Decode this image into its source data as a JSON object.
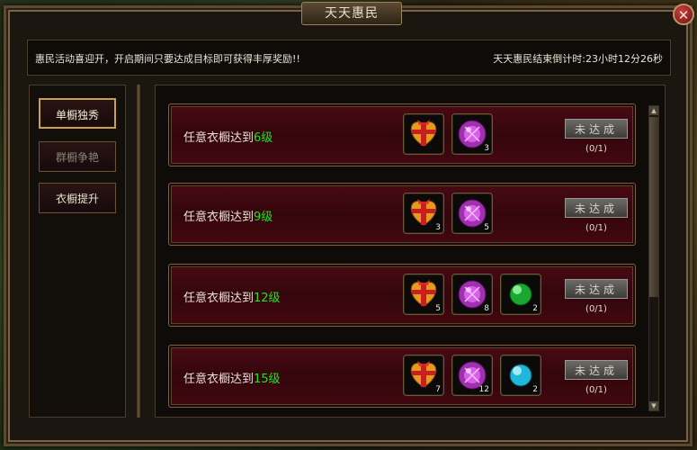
{
  "window": {
    "title": "天天惠民",
    "close_glyph": "✕"
  },
  "notice": {
    "left": "惠民活动喜迎开，开启期间只要达成目标即可获得丰厚奖励!!",
    "right": "天天惠民结束倒计时:23小时12分26秒"
  },
  "tabs": [
    {
      "label": "单橱独秀",
      "state": "active"
    },
    {
      "label": "群橱争艳",
      "state": "disabled"
    },
    {
      "label": "衣橱提升",
      "state": "normal"
    }
  ],
  "rows": [
    {
      "label_prefix": "任意衣橱达到",
      "level": "6级",
      "status": "未达成",
      "progress": "(0/1)",
      "items": [
        {
          "icon": "gift-box-icon",
          "count": ""
        },
        {
          "icon": "purple-orb-icon",
          "count": "3"
        }
      ]
    },
    {
      "label_prefix": "任意衣橱达到",
      "level": "9级",
      "status": "未达成",
      "progress": "(0/1)",
      "items": [
        {
          "icon": "gift-box-icon",
          "count": "3"
        },
        {
          "icon": "purple-orb-icon",
          "count": "5"
        }
      ]
    },
    {
      "label_prefix": "任意衣橱达到",
      "level": "12级",
      "status": "未达成",
      "progress": "(0/1)",
      "items": [
        {
          "icon": "gift-box-icon",
          "count": "5"
        },
        {
          "icon": "purple-orb-icon",
          "count": "8"
        },
        {
          "icon": "green-gem-icon",
          "count": "2"
        }
      ]
    },
    {
      "label_prefix": "任意衣橱达到",
      "level": "15级",
      "status": "未达成",
      "progress": "(0/1)",
      "items": [
        {
          "icon": "gift-box-icon",
          "count": "7"
        },
        {
          "icon": "purple-orb-icon",
          "count": "12"
        },
        {
          "icon": "cyan-gem-icon",
          "count": "2"
        }
      ]
    }
  ],
  "colors": {
    "level_text": "#20e020",
    "row_bg": "#3c0810",
    "frame": "#7a6040"
  }
}
